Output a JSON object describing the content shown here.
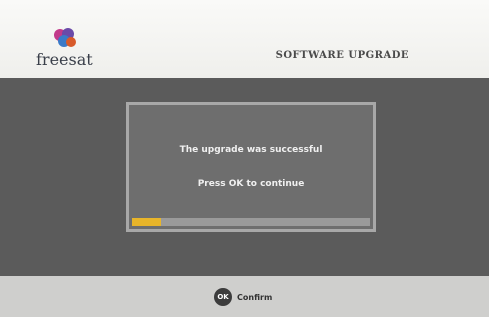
{
  "brand": {
    "name": "freesat"
  },
  "header": {
    "title": "SOFTWARE UPGRADE"
  },
  "dialog": {
    "message": "The upgrade was successful",
    "instruction": "Press OK to continue",
    "progress": 0.12
  },
  "footer": {
    "ok_key": "OK",
    "confirm_label": "Confirm"
  },
  "colors": {
    "header_bg": "#f4f4f2",
    "main_bg": "#5b5b5b",
    "dialog_bg": "#6e6e6e",
    "dialog_border": "#a8a8a8",
    "progress_fill": "#e8b52a",
    "footer_bg": "#cfcfcd"
  }
}
